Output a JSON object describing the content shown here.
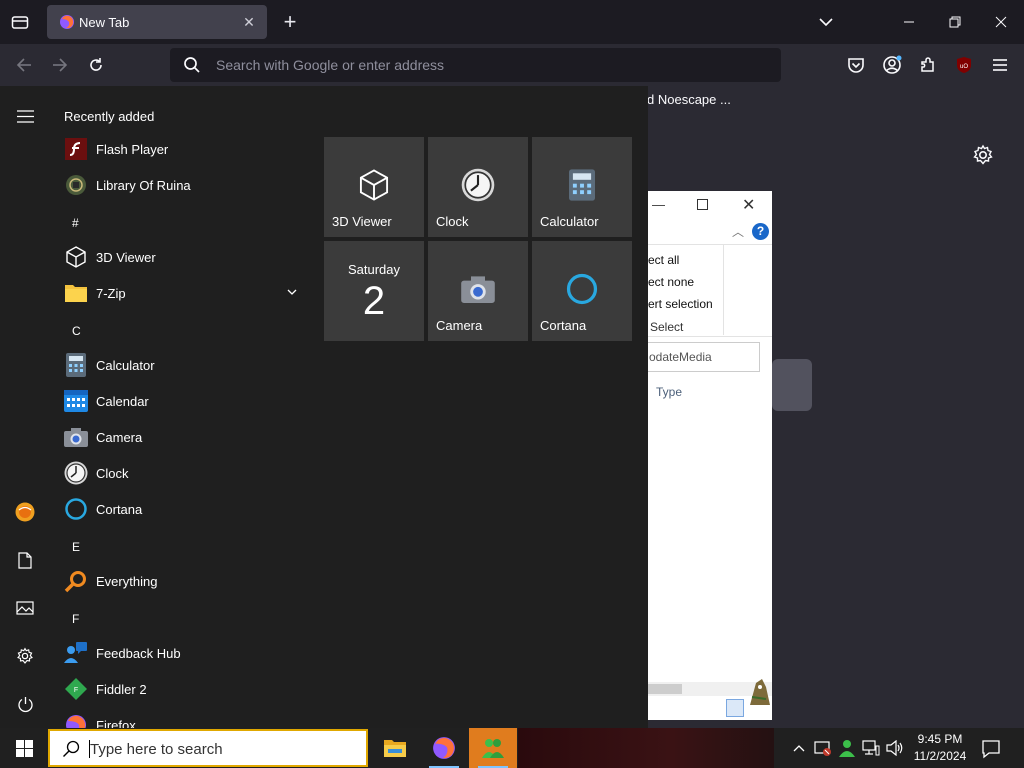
{
  "browser": {
    "tab": {
      "title": "New Tab",
      "close": "✕"
    },
    "new_tab": "+",
    "urlbar": {
      "placeholder": "Search with Google or enter address"
    }
  },
  "background_page": {
    "shortcut_text": "d Noescape ...",
    "explorer": {
      "ribbon": [
        "ect all",
        "ect none",
        "ert selection"
      ],
      "group_label": "Select",
      "search_text": "odateMedia",
      "column_type": "Type",
      "help": "?"
    }
  },
  "start_menu": {
    "recently_added_header": "Recently added",
    "recent": [
      {
        "name": "Flash Player",
        "icon": "flash-player-icon"
      },
      {
        "name": "Library Of Ruina",
        "icon": "library-of-ruina-icon"
      }
    ],
    "groups": [
      {
        "letter": "#",
        "apps": [
          {
            "name": "3D Viewer",
            "icon": "cube-icon"
          },
          {
            "name": "7-Zip",
            "icon": "folder-icon",
            "expandable": true
          }
        ]
      },
      {
        "letter": "C",
        "apps": [
          {
            "name": "Calculator",
            "icon": "calculator-icon"
          },
          {
            "name": "Calendar",
            "icon": "calendar-icon"
          },
          {
            "name": "Camera",
            "icon": "camera-icon"
          },
          {
            "name": "Clock",
            "icon": "clock-icon"
          },
          {
            "name": "Cortana",
            "icon": "cortana-icon"
          }
        ]
      },
      {
        "letter": "E",
        "apps": [
          {
            "name": "Everything",
            "icon": "search-magnifier-icon"
          }
        ]
      },
      {
        "letter": "F",
        "apps": [
          {
            "name": "Feedback Hub",
            "icon": "feedback-hub-icon"
          },
          {
            "name": "Fiddler 2",
            "icon": "fiddler-icon"
          },
          {
            "name": "Firefox",
            "icon": "firefox-icon"
          }
        ]
      }
    ],
    "tiles": [
      {
        "label": "3D Viewer",
        "icon": "cube-icon"
      },
      {
        "label": "Clock",
        "icon": "clock-icon"
      },
      {
        "label": "Calculator",
        "icon": "calculator-icon"
      },
      {
        "label": "",
        "calendar_day": "Saturday",
        "calendar_date": "2",
        "icon": "calendar-live-tile"
      },
      {
        "label": "Camera",
        "icon": "camera-icon"
      },
      {
        "label": "Cortana",
        "icon": "cortana-icon"
      }
    ]
  },
  "taskbar": {
    "search_placeholder": "Type here to search",
    "clock": {
      "time": "9:45 PM",
      "date": "11/2/2024"
    },
    "apps": [
      "file-explorer-icon",
      "firefox-icon",
      "green-app-icon"
    ]
  },
  "colors": {
    "accent": "#e07c1e",
    "start_bg": "#1f1f1f",
    "tile_bg": "#3b3b3b",
    "search_border": "#e0a800"
  }
}
